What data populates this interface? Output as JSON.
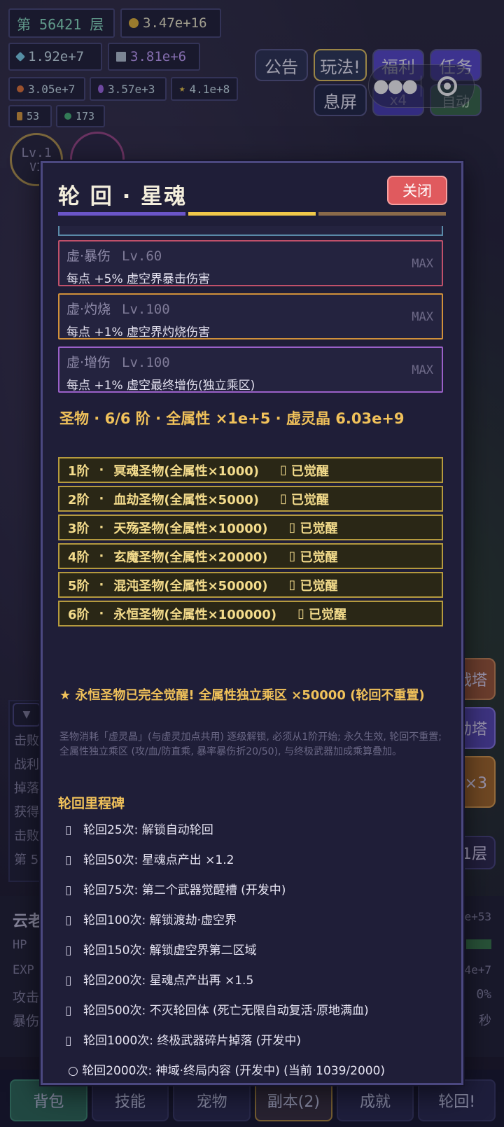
{
  "hud": {
    "floor": "第 56421 层",
    "gold": "3.47e+16",
    "gem": "1.92e+7",
    "ticket": "3.81e+6",
    "res1": "3.05e+7",
    "res2": "3.57e+3",
    "res3": "4.1e+8",
    "res4": "53",
    "res5": "173",
    "level": "Lv.1",
    "vip": "VI"
  },
  "top_buttons": {
    "notice": "公告",
    "howto": "玩法!",
    "welfare": "福利",
    "quest": "任务",
    "screen_off": "息屏",
    "speed": "x4",
    "auto": "自动"
  },
  "side_buttons": [
    "战塔",
    "劫塔",
    "召×3",
    "1层"
  ],
  "bg_fragments": {
    "log": [
      "击败",
      "战利",
      "掉落",
      "获得",
      "击败",
      "第 5"
    ],
    "char_name": "云老",
    "hp": "HP",
    "exp": "EXP",
    "atk": "攻击",
    "crit": "暴伤",
    "right_vals": [
      "e+53",
      "4e+7",
      "0%",
      "秒"
    ]
  },
  "bottom_tabs": [
    "背包",
    "技能",
    "宠物",
    "副本(2)",
    "成就",
    "轮回!"
  ],
  "modal": {
    "title": "轮 回 · 星魂",
    "close": "关闭",
    "colors": {
      "bar1": "#6a55c8",
      "bar2": "#f0c84a",
      "bar3": "#8a6a4a"
    },
    "stats": [
      {
        "name": "虚·暴伤",
        "level": "Lv.60",
        "desc": "每点 +5% 虚空界暴击伤害",
        "max": "MAX",
        "border": "#c0506a"
      },
      {
        "name": "虚·灼烧",
        "level": "Lv.100",
        "desc": "每点 +1% 虚空界灼烧伤害",
        "max": "MAX",
        "border": "#d0903a"
      },
      {
        "name": "虚·增伤",
        "level": "Lv.100",
        "desc": "每点 +1% 虚空最终增伤(独立乘区)",
        "max": "MAX",
        "border": "#9a60c8"
      }
    ],
    "relic_header": "圣物 · 6/6 阶 · 全属性 ×1e+5 · 虚灵晶 6.03e+9",
    "relics": [
      {
        "tier": "1阶",
        "name": "冥魂圣物(全属性×1000)",
        "status": "已觉醒"
      },
      {
        "tier": "2阶",
        "name": "血劫圣物(全属性×5000)",
        "status": "已觉醒"
      },
      {
        "tier": "3阶",
        "name": "天殇圣物(全属性×10000)",
        "status": "已觉醒"
      },
      {
        "tier": "4阶",
        "name": "玄魔圣物(全属性×20000)",
        "status": "已觉醒"
      },
      {
        "tier": "5阶",
        "name": "混沌圣物(全属性×50000)",
        "status": "已觉醒"
      },
      {
        "tier": "6阶",
        "name": "永恒圣物(全属性×100000)",
        "status": "已觉醒"
      }
    ],
    "awake_note": "★ 永恒圣物已完全觉醒! 全属性独立乘区 ×50000 (轮回不重置)",
    "hint": "圣物消耗「虚灵晶」(与虚灵加点共用) 逐级解锁, 必须从1阶开始; 永久生效, 轮回不重置; 全属性独立乘区 (攻/血/防直乘, 暴率暴伤折20/50), 与终极武器加成乘算叠加。",
    "milestone_title": "轮回里程碑",
    "milestones": [
      "轮回25次: 解锁自动轮回",
      "轮回50次: 星魂点产出 ×1.2",
      "轮回75次: 第二个武器觉醒槽 (开发中)",
      "轮回100次: 解锁渡劫·虚空界",
      "轮回150次: 解锁虚空界第二区域",
      "轮回200次: 星魂点产出再 ×1.5",
      "轮回500次: 不灭轮回体 (死亡无限自动复活·原地满血)",
      "轮回1000次: 终极武器碎片掉落 (开发中)"
    ],
    "last_milestone": "○ 轮回2000次: 神域·终局内容 (开发中) (当前 1039/2000)"
  }
}
